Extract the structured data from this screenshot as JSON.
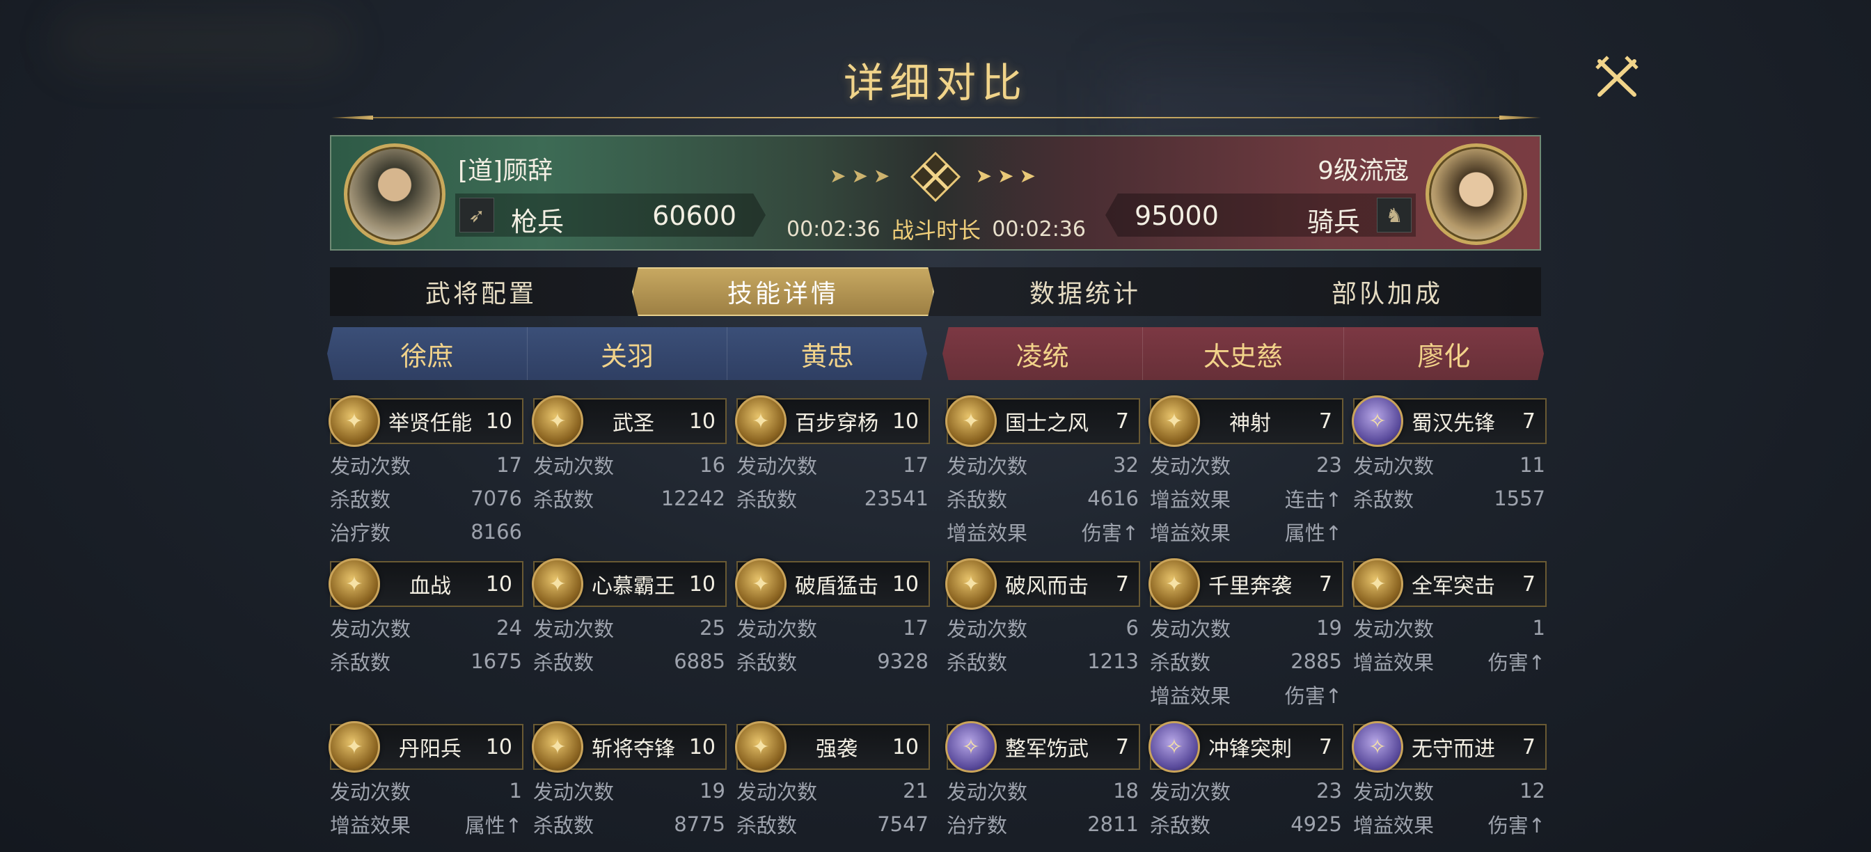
{
  "title": "详细对比",
  "colors": {
    "gold": "#f1d48a",
    "blue_team": "#3b4f78",
    "red_team": "#7c3843"
  },
  "left_player": {
    "name": "[道]顾辞",
    "unit_type": "枪兵",
    "unit_icon": "spear-icon",
    "troops": "60600"
  },
  "right_player": {
    "name": "9级流寇",
    "unit_type": "骑兵",
    "unit_icon": "horse-icon",
    "troops": "95000"
  },
  "battle": {
    "time_left": "00:02:36",
    "label": "战斗时长",
    "time_right": "00:02:36"
  },
  "tabs": [
    "武将配置",
    "技能详情",
    "数据统计",
    "部队加成"
  ],
  "active_tab": "技能详情",
  "generals_left": [
    "徐庶",
    "关羽",
    "黄忠"
  ],
  "generals_right": [
    "凌统",
    "太史慈",
    "廖化"
  ],
  "skills": [
    [
      {
        "name": "举贤任能",
        "level": "10",
        "icon": "book-icon",
        "tone": "gold",
        "stats": [
          [
            "发动次数",
            "17"
          ],
          [
            "杀敌数",
            "7076"
          ],
          [
            "治疗数",
            "8166"
          ]
        ]
      },
      {
        "name": "武圣",
        "level": "10",
        "icon": "warrior-icon",
        "tone": "gold",
        "stats": [
          [
            "发动次数",
            "16"
          ],
          [
            "杀敌数",
            "12242"
          ]
        ]
      },
      {
        "name": "百步穿杨",
        "level": "10",
        "icon": "bow-icon",
        "tone": "gold",
        "stats": [
          [
            "发动次数",
            "17"
          ],
          [
            "杀敌数",
            "23541"
          ]
        ]
      },
      {
        "name": "国士之风",
        "level": "7",
        "icon": "scroll-icon",
        "tone": "gold",
        "stats": [
          [
            "发动次数",
            "32"
          ],
          [
            "杀敌数",
            "4616"
          ],
          [
            "增益效果",
            "伤害↑"
          ]
        ]
      },
      {
        "name": "神射",
        "level": "7",
        "icon": "archer-icon",
        "tone": "gold",
        "stats": [
          [
            "发动次数",
            "23"
          ],
          [
            "增益效果",
            "连击↑"
          ],
          [
            "增益效果",
            "属性↑"
          ]
        ]
      },
      {
        "name": "蜀汉先锋",
        "level": "7",
        "icon": "vanguard-icon",
        "tone": "purple",
        "stats": [
          [
            "发动次数",
            "11"
          ],
          [
            "杀敌数",
            "1557"
          ]
        ]
      }
    ],
    [
      {
        "name": "血战",
        "level": "10",
        "icon": "fighter-icon",
        "tone": "gold",
        "stats": [
          [
            "发动次数",
            "24"
          ],
          [
            "杀敌数",
            "1675"
          ]
        ]
      },
      {
        "name": "心慕霸王",
        "level": "10",
        "icon": "helmet-icon",
        "tone": "gold",
        "stats": [
          [
            "发动次数",
            "25"
          ],
          [
            "杀敌数",
            "6885"
          ]
        ]
      },
      {
        "name": "破盾猛击",
        "level": "10",
        "icon": "strike-icon",
        "tone": "gold",
        "stats": [
          [
            "发动次数",
            "17"
          ],
          [
            "杀敌数",
            "9328"
          ]
        ]
      },
      {
        "name": "破风而击",
        "level": "7",
        "icon": "wind-icon",
        "tone": "gold",
        "stats": [
          [
            "发动次数",
            "6"
          ],
          [
            "杀敌数",
            "1213"
          ]
        ]
      },
      {
        "name": "千里奔袭",
        "level": "7",
        "icon": "charge-icon",
        "tone": "gold",
        "stats": [
          [
            "发动次数",
            "19"
          ],
          [
            "杀敌数",
            "2885"
          ],
          [
            "增益效果",
            "伤害↑"
          ]
        ]
      },
      {
        "name": "全军突击",
        "level": "7",
        "icon": "assault-icon",
        "tone": "gold",
        "stats": [
          [
            "发动次数",
            "1"
          ],
          [
            "增益效果",
            "伤害↑"
          ]
        ]
      }
    ],
    [
      {
        "name": "丹阳兵",
        "level": "10",
        "icon": "soldier-icon",
        "tone": "gold",
        "stats": [
          [
            "发动次数",
            "1"
          ],
          [
            "增益效果",
            "属性↑"
          ]
        ]
      },
      {
        "name": "斩将夺锋",
        "level": "10",
        "icon": "blade-icon",
        "tone": "gold",
        "stats": [
          [
            "发动次数",
            "19"
          ],
          [
            "杀敌数",
            "8775"
          ]
        ]
      },
      {
        "name": "强袭",
        "level": "10",
        "icon": "raid-icon",
        "tone": "gold",
        "stats": [
          [
            "发动次数",
            "21"
          ],
          [
            "杀敌数",
            "7547"
          ]
        ]
      },
      {
        "name": "整军饬武",
        "level": "7",
        "icon": "banner-icon",
        "tone": "purple",
        "stats": [
          [
            "发动次数",
            "18"
          ],
          [
            "治疗数",
            "2811"
          ]
        ]
      },
      {
        "name": "冲锋突刺",
        "level": "7",
        "icon": "lancer-icon",
        "tone": "purple",
        "stats": [
          [
            "发动次数",
            "23"
          ],
          [
            "杀敌数",
            "4925"
          ]
        ]
      },
      {
        "name": "无守而进",
        "level": "7",
        "icon": "advance-icon",
        "tone": "purple",
        "stats": [
          [
            "发动次数",
            "12"
          ],
          [
            "增益效果",
            "伤害↑"
          ]
        ]
      }
    ]
  ]
}
